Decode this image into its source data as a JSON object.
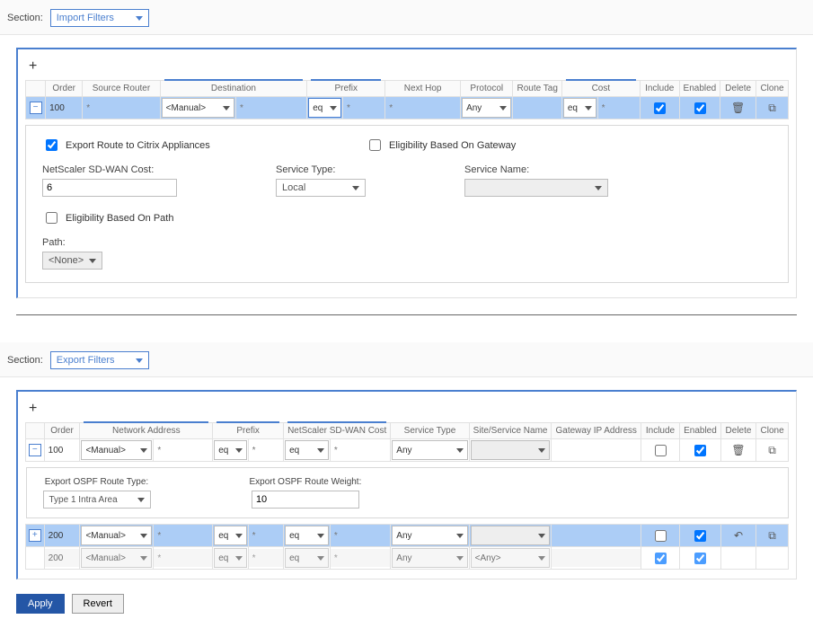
{
  "sections": {
    "label": "Section:",
    "import": "Import Filters",
    "export": "Export Filters"
  },
  "importTable": {
    "headers": {
      "order": "Order",
      "sourceRouter": "Source Router",
      "destination": "Destination",
      "prefix": "Prefix",
      "nextHop": "Next Hop",
      "protocol": "Protocol",
      "routeTag": "Route Tag",
      "cost": "Cost",
      "include": "Include",
      "enabled": "Enabled",
      "delete": "Delete",
      "clone": "Clone"
    },
    "row": {
      "toggle": "−",
      "order": "100",
      "sourceRouter_ph": "*",
      "destination": "<Manual>",
      "destination2_ph": "*",
      "prefix_op": "eq",
      "prefix_ph": "*",
      "nextHop_ph": "*",
      "protocol": "Any",
      "routeTag": "",
      "cost_op": "eq",
      "cost_ph": "*",
      "include": true,
      "enabled": true
    },
    "details": {
      "exportCitrix_label": "Export Route to Citrix Appliances",
      "exportCitrix": true,
      "eligGateway_label": "Eligibility Based On Gateway",
      "eligGateway": false,
      "sdwanCost_label": "NetScaler SD-WAN Cost:",
      "sdwanCost_val": "6",
      "serviceType_label": "Service Type:",
      "serviceType_val": "Local",
      "serviceName_label": "Service Name:",
      "serviceName_val": "",
      "eligPath_label": "Eligibility Based On Path",
      "eligPath": false,
      "path_label": "Path:",
      "path_val": "<None>"
    }
  },
  "exportTable": {
    "headers": {
      "order": "Order",
      "networkAddress": "Network Address",
      "prefix": "Prefix",
      "sdwanCost": "NetScaler SD-WAN Cost",
      "serviceType": "Service Type",
      "siteService": "Site/Service Name",
      "gatewayIp": "Gateway IP Address",
      "include": "Include",
      "enabled": "Enabled",
      "delete": "Delete",
      "clone": "Clone"
    },
    "row1": {
      "toggle": "−",
      "order": "100",
      "netAddr": "<Manual>",
      "netAddr_ph": "*",
      "prefix_op": "eq",
      "prefix_ph": "*",
      "cost_op": "eq",
      "cost_ph": "*",
      "serviceType": "Any",
      "siteService": "",
      "gatewayIp": "",
      "include": false,
      "enabled": true
    },
    "details1": {
      "routeType_label": "Export OSPF Route Type:",
      "routeType_val": "Type 1 Intra Area",
      "routeWeight_label": "Export OSPF Route Weight:",
      "routeWeight_val": "10"
    },
    "row2": {
      "toggle": "+",
      "order": "200",
      "netAddr": "<Manual>",
      "netAddr_ph": "*",
      "prefix_op": "eq",
      "prefix_ph": "*",
      "cost_op": "eq",
      "cost_ph": "*",
      "serviceType": "Any",
      "siteService": "",
      "gatewayIp": "",
      "include": false,
      "enabled": true
    },
    "row3": {
      "order": "200",
      "netAddr": "<Manual>",
      "netAddr_ph": "*",
      "prefix_op": "eq",
      "prefix_ph": "*",
      "cost_op": "eq",
      "cost_ph": "*",
      "serviceType": "Any",
      "siteService": "<Any>",
      "gatewayIp": "",
      "include": true,
      "enabled": true
    }
  },
  "buttons": {
    "apply": "Apply",
    "revert": "Revert"
  },
  "star": "*"
}
